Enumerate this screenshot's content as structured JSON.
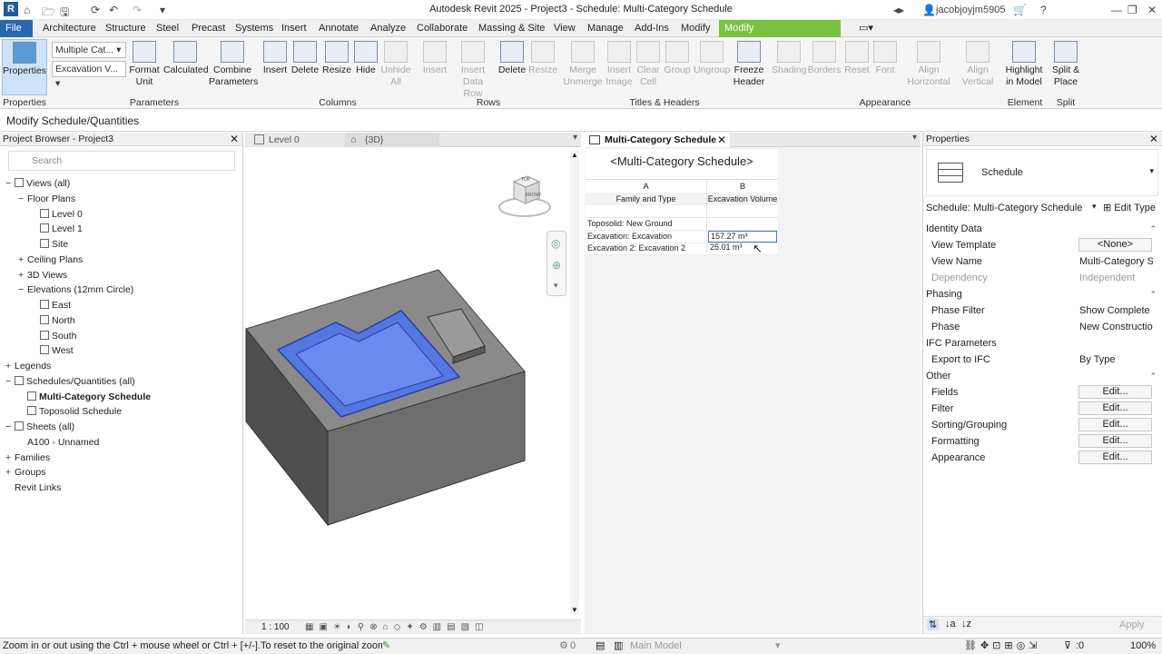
{
  "titlebar": {
    "app_letter": "R",
    "title": "Autodesk Revit 2025 - Project3 - Schedule: Multi-Category Schedule",
    "user": "jacobjoyjm5905"
  },
  "menu": {
    "file": "File",
    "tabs": [
      "Architecture",
      "Structure",
      "Steel",
      "Precast",
      "Systems",
      "Insert",
      "Annotate",
      "Analyze",
      "Collaborate",
      "Massing & Site",
      "View",
      "Manage",
      "Add-Ins",
      "Modify"
    ],
    "context_tab": "Modify Schedule/Quantities"
  },
  "ribbon": {
    "properties_label": "Properties",
    "combo1": "Multiple Cat...",
    "combo2": "Excavation V...",
    "buttons": {
      "format_unit": "Format Unit",
      "calculated": "Calculated",
      "combine": "Combine Parameters",
      "insert": "Insert",
      "delete": "Delete",
      "resize": "Resize",
      "hide": "Hide",
      "unhide": "Unhide All",
      "insert_row": "Insert",
      "insert_data_row": "Insert Data Row",
      "delete_row": "Delete",
      "resize_row": "Resize",
      "merge": "Merge Unmerge",
      "insert_image": "Insert Image",
      "clear_cell": "Clear Cell",
      "group": "Group",
      "ungroup": "Ungroup",
      "freeze": "Freeze Header",
      "shading": "Shading",
      "borders": "Borders",
      "reset": "Reset",
      "font": "Font",
      "align_h": "Align Horizontal",
      "align_v": "Align Vertical",
      "highlight": "Highlight in Model",
      "split": "Split & Place"
    },
    "panels": {
      "properties": "Properties",
      "parameters": "Parameters",
      "columns": "Columns",
      "rows": "Rows",
      "titles": "Titles & Headers",
      "appearance": "Appearance",
      "element": "Element",
      "split": "Split"
    }
  },
  "context_bar": "Modify Schedule/Quantities",
  "project_browser": {
    "header": "Project Browser - Project3",
    "search_placeholder": "Search",
    "items": [
      {
        "toggle": "−",
        "label": "Views (all)"
      },
      {
        "toggle": "−",
        "label": "Floor Plans"
      },
      {
        "toggle": "",
        "label": "Level 0"
      },
      {
        "toggle": "",
        "label": "Level 1"
      },
      {
        "toggle": "",
        "label": "Site"
      },
      {
        "toggle": "+",
        "label": "Ceiling Plans"
      },
      {
        "toggle": "+",
        "label": "3D Views"
      },
      {
        "toggle": "−",
        "label": "Elevations (12mm Circle)"
      },
      {
        "toggle": "",
        "label": "East"
      },
      {
        "toggle": "",
        "label": "North"
      },
      {
        "toggle": "",
        "label": "South"
      },
      {
        "toggle": "",
        "label": "West"
      },
      {
        "toggle": "+",
        "label": "Legends"
      },
      {
        "toggle": "−",
        "label": "Schedules/Quantities (all)"
      },
      {
        "toggle": "",
        "label": "Multi-Category Schedule"
      },
      {
        "toggle": "",
        "label": "Toposolid Schedule"
      },
      {
        "toggle": "−",
        "label": "Sheets (all)"
      },
      {
        "toggle": "",
        "label": "A100 - Unnamed"
      },
      {
        "toggle": "+",
        "label": "Families"
      },
      {
        "toggle": "+",
        "label": "Groups"
      },
      {
        "toggle": "",
        "label": "Revit Links"
      }
    ]
  },
  "view_tabs": [
    "Level 0",
    "{3D}"
  ],
  "view_scale": "1 : 100",
  "viewcube": {
    "top": "TOP",
    "front": "FRONT"
  },
  "schedule": {
    "tab": "Multi-Category Schedule",
    "title": "<Multi-Category Schedule>",
    "col_letters": [
      "A",
      "B"
    ],
    "headers": [
      "Family and Type",
      "Excavation Volume"
    ],
    "rows": [
      [
        "Toposolid: New Ground",
        ""
      ],
      [
        "Excavation: Excavation",
        "157.27 m³"
      ],
      [
        "Excavation 2: Excavation 2",
        "25.01 m³"
      ]
    ]
  },
  "properties": {
    "header": "Properties",
    "type": "Schedule",
    "selector": "Schedule: Multi-Category Schedule",
    "edit_type": "Edit Type",
    "sections": {
      "identity": "Identity Data",
      "phasing": "Phasing",
      "ifc": "IFC Parameters",
      "other": "Other"
    },
    "rows": {
      "view_template": {
        "k": "View Template",
        "v": "<None>"
      },
      "view_name": {
        "k": "View Name",
        "v": "Multi-Category Schedule"
      },
      "dependency": {
        "k": "Dependency",
        "v": "Independent"
      },
      "phase_filter": {
        "k": "Phase Filter",
        "v": "Show Complete"
      },
      "phase": {
        "k": "Phase",
        "v": "New Construction"
      },
      "export_ifc": {
        "k": "Export to IFC",
        "v": "By Type"
      },
      "fields": {
        "k": "Fields",
        "v": "Edit..."
      },
      "filter": {
        "k": "Filter",
        "v": "Edit..."
      },
      "sorting": {
        "k": "Sorting/Grouping",
        "v": "Edit..."
      },
      "formatting": {
        "k": "Formatting",
        "v": "Edit..."
      },
      "appearance": {
        "k": "Appearance",
        "v": "Edit..."
      }
    },
    "apply": "Apply"
  },
  "status": {
    "hint": "Zoom in or out using the Ctrl + mouse wheel or Ctrl + [+/-].To reset to the original zoom le",
    "workset_count": "0",
    "model": "Main Model",
    "filter_count": ":0",
    "zoom": "100%"
  }
}
